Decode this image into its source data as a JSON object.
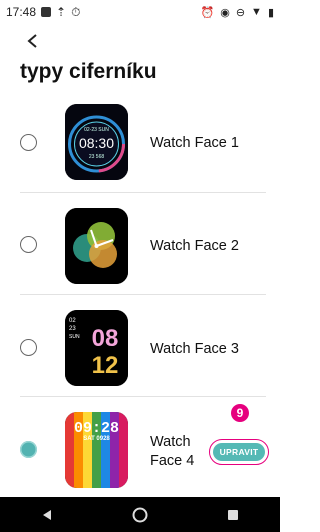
{
  "status_bar": {
    "time": "17:48"
  },
  "header": {
    "title": "typy ciferníku"
  },
  "faces": [
    {
      "label": "Watch Face 1",
      "selected": false,
      "thumb": {
        "date": "02-23 SUN",
        "time": "08:30",
        "steps": "23 568"
      }
    },
    {
      "label": "Watch Face 2",
      "selected": false
    },
    {
      "label": "Watch Face 3",
      "selected": false,
      "thumb": {
        "hour": "08",
        "minute": "12",
        "side_top": "02",
        "side_mid": "23",
        "side_bottom": "SUN"
      }
    },
    {
      "label_line1": "Watch",
      "label_line2": "Face 4",
      "selected": true,
      "thumb": {
        "time": "09:28",
        "date": "SAT 0928"
      }
    }
  ],
  "edit": {
    "label": "UPRAVIT",
    "step_badge": "9"
  },
  "colors": {
    "accent": "#55b9b5",
    "highlight": "#e6007e"
  },
  "icons": {
    "back": "arrow-left-icon",
    "nav_back": "triangle-back-icon",
    "nav_home": "circle-home-icon",
    "nav_recent": "square-recent-icon"
  }
}
